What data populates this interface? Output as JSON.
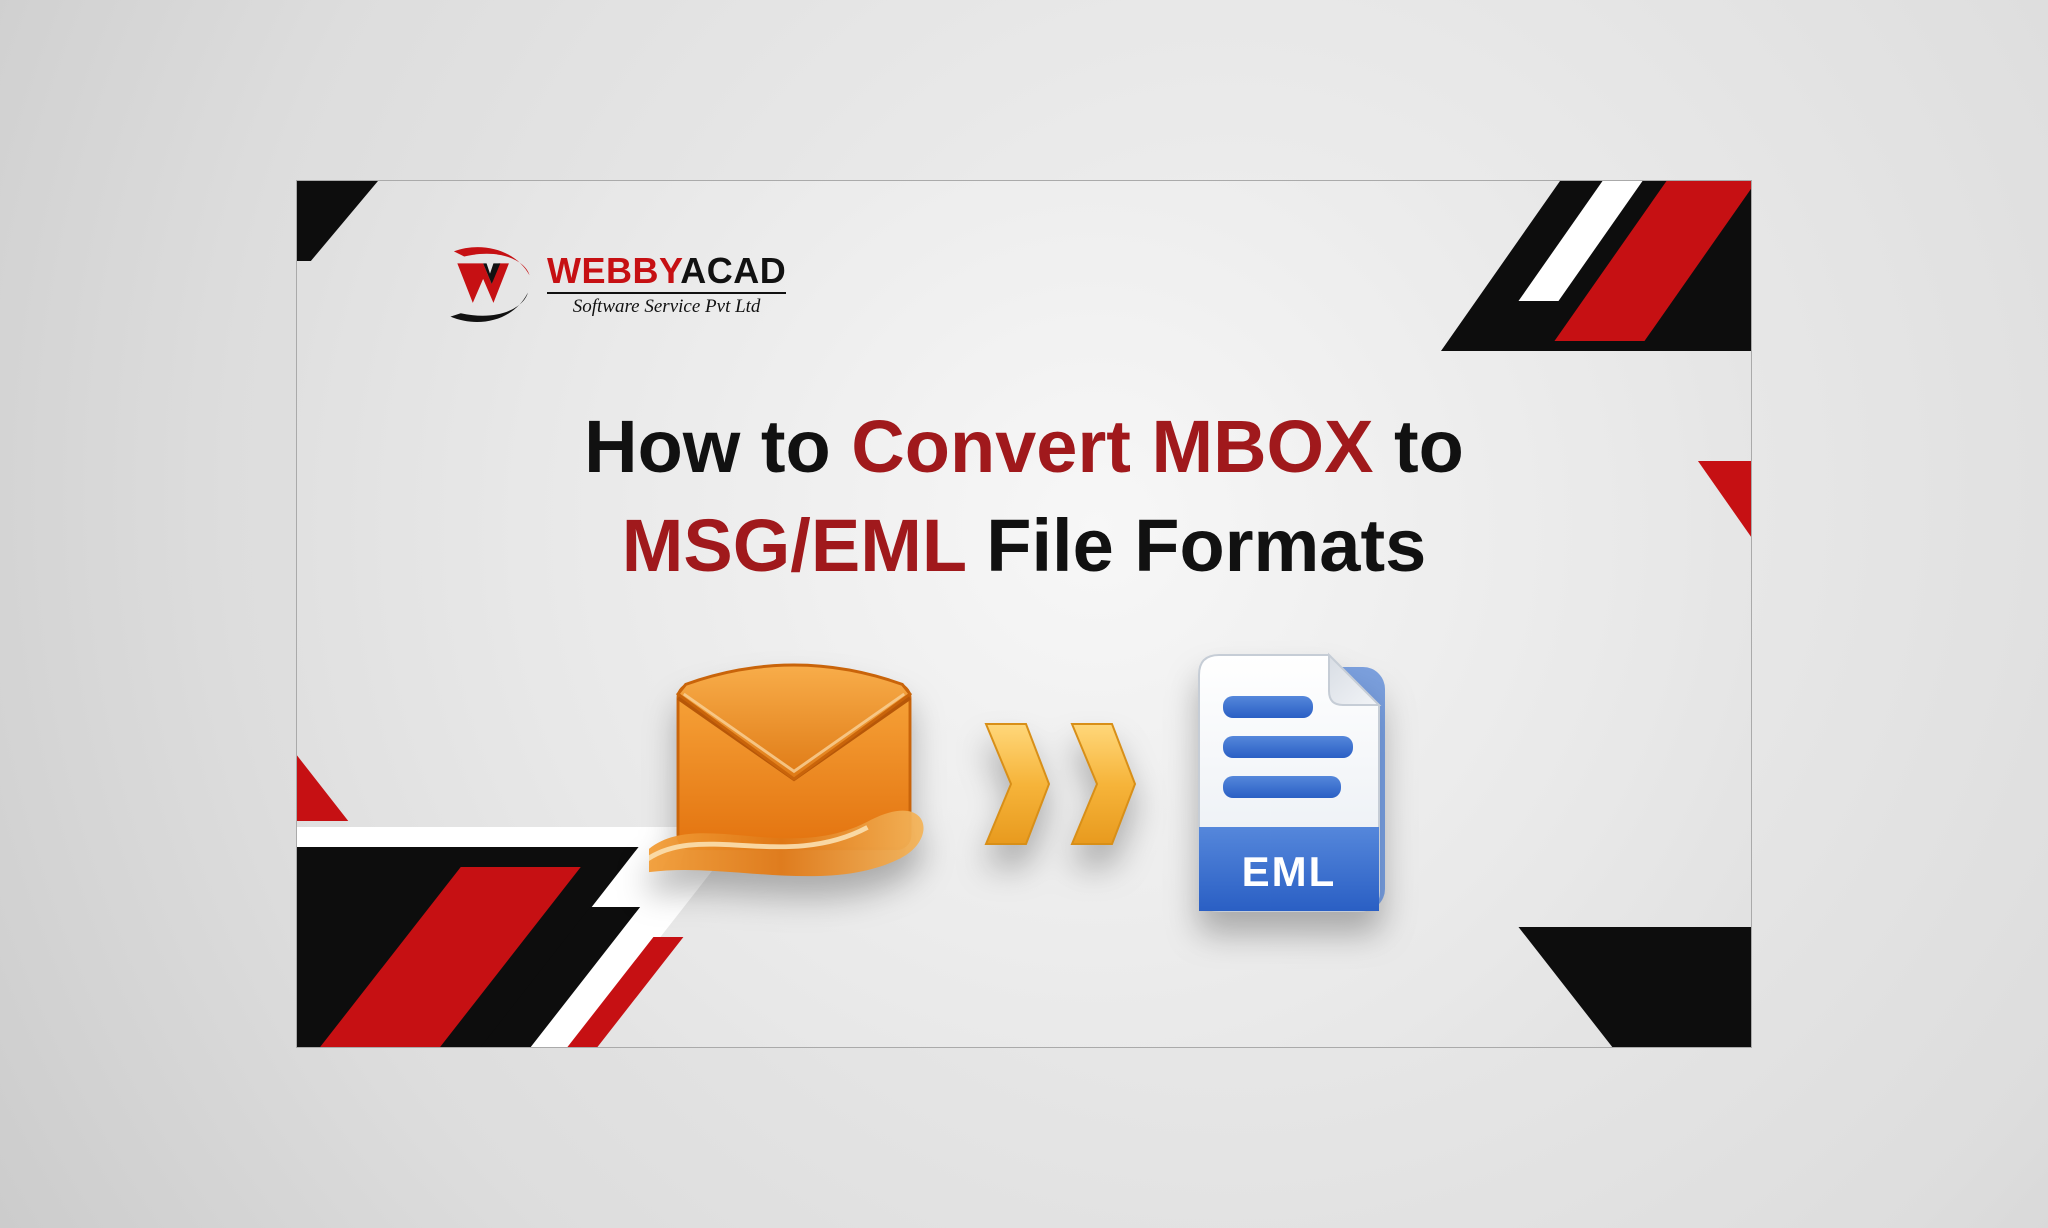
{
  "logo": {
    "brand_first": "WEBBY",
    "brand_second": "ACAD",
    "tagline": "Software Service Pvt Ltd"
  },
  "title": {
    "line1_prefix": "How to ",
    "line1_highlight": "Convert MBOX",
    "line1_suffix": " to",
    "line2_highlight": "MSG/EML",
    "line2_suffix": " File Formats"
  },
  "illustration": {
    "file_label": "EML"
  },
  "colors": {
    "red": "#c61013",
    "dark_red": "#a0191c",
    "black": "#0d0d0d",
    "orange": "#ef8a1e",
    "orange_dark": "#d66b0c",
    "amber": "#f6b43a",
    "blue": "#2f6bd1",
    "blue_light": "#5587db",
    "white": "#ffffff"
  }
}
